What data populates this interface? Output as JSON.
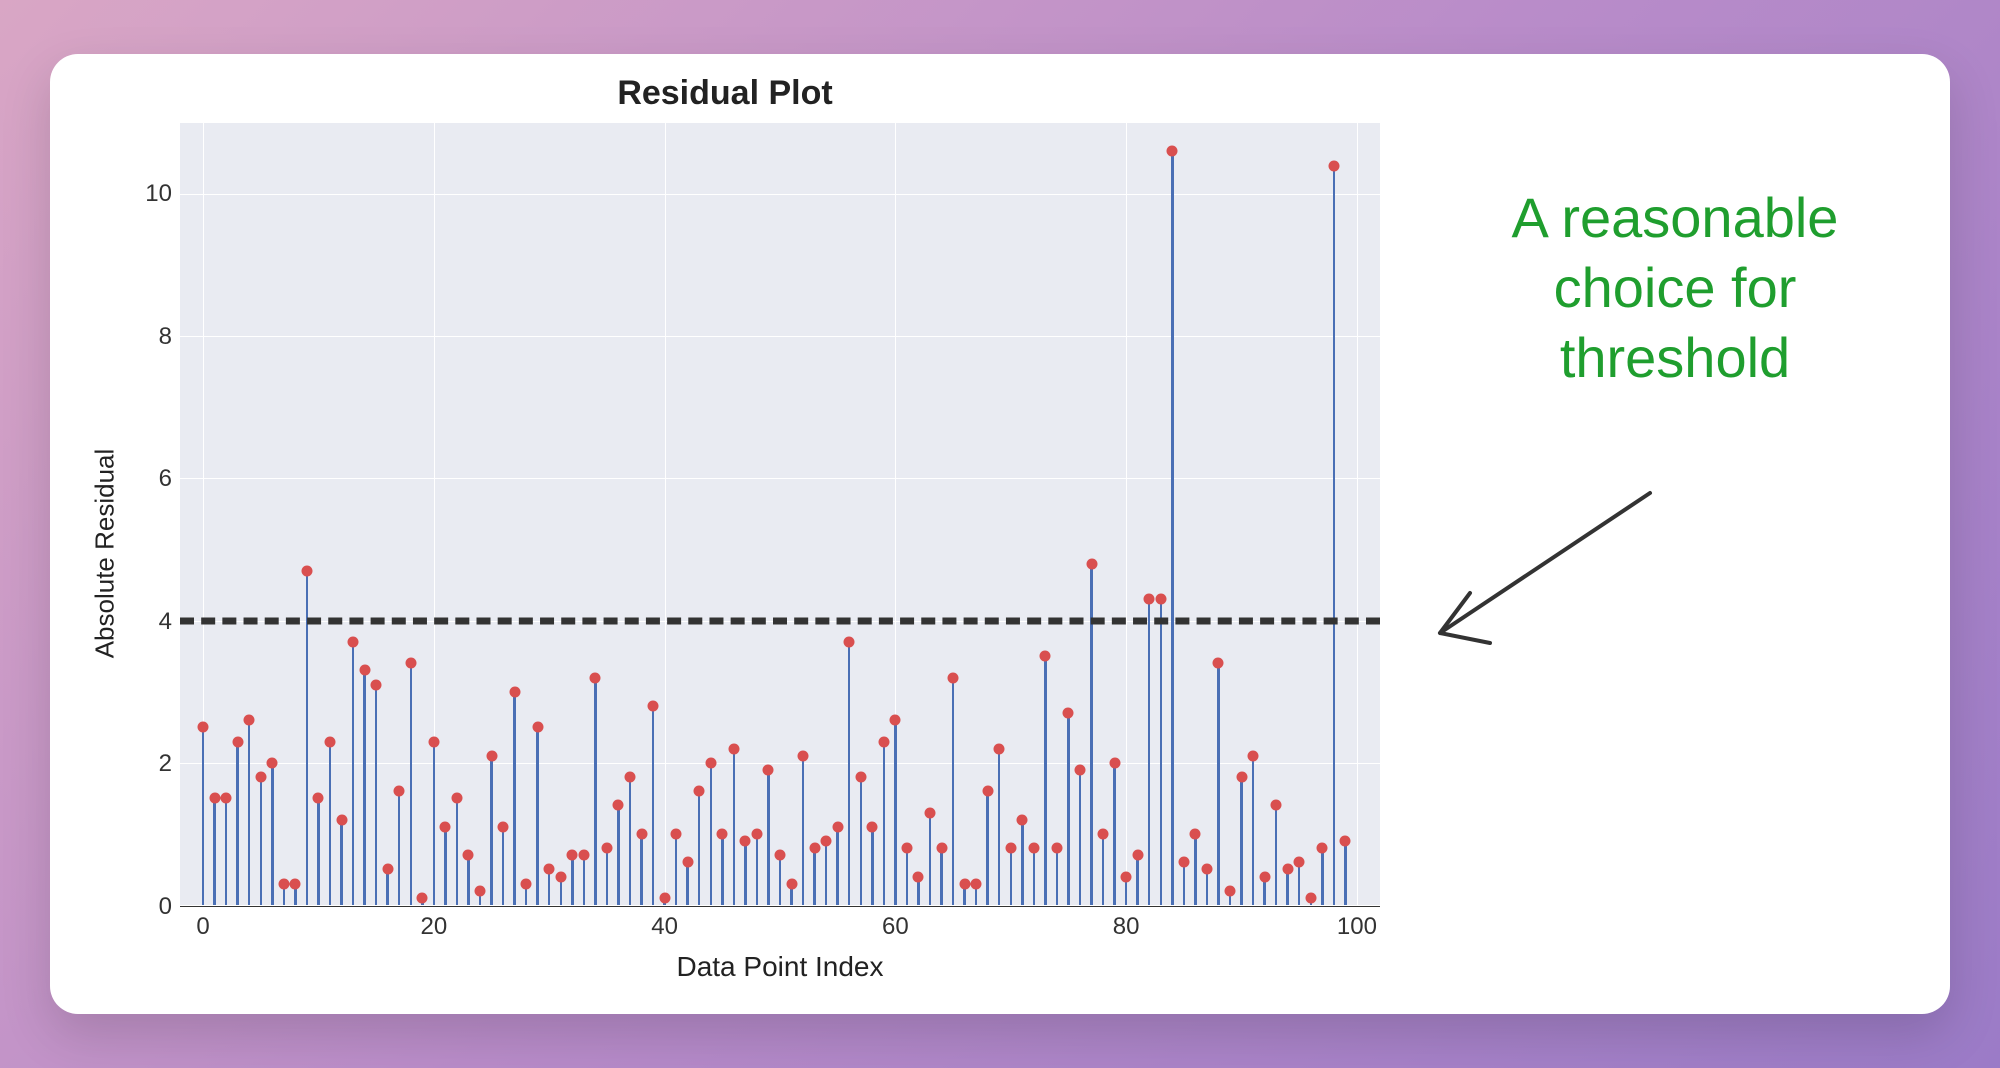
{
  "chart_data": {
    "type": "stem",
    "title": "Residual Plot",
    "xlabel": "Data Point Index",
    "ylabel": "Absolute Residual",
    "xlim": [
      -2,
      102
    ],
    "ylim": [
      0,
      11
    ],
    "xticks": [
      0,
      20,
      40,
      60,
      80,
      100
    ],
    "yticks": [
      0,
      2,
      4,
      6,
      8,
      10
    ],
    "threshold": 4,
    "x": [
      0,
      1,
      2,
      3,
      4,
      5,
      6,
      7,
      8,
      9,
      10,
      11,
      12,
      13,
      14,
      15,
      16,
      17,
      18,
      19,
      20,
      21,
      22,
      23,
      24,
      25,
      26,
      27,
      28,
      29,
      30,
      31,
      32,
      33,
      34,
      35,
      36,
      37,
      38,
      39,
      40,
      41,
      42,
      43,
      44,
      45,
      46,
      47,
      48,
      49,
      50,
      51,
      52,
      53,
      54,
      55,
      56,
      57,
      58,
      59,
      60,
      61,
      62,
      63,
      64,
      65,
      66,
      67,
      68,
      69,
      70,
      71,
      72,
      73,
      74,
      75,
      76,
      77,
      78,
      79,
      80,
      81,
      82,
      83,
      84,
      85,
      86,
      87,
      88,
      89,
      90,
      91,
      92,
      93,
      94,
      95,
      96,
      97,
      98,
      99
    ],
    "values": [
      2.5,
      1.5,
      1.5,
      2.3,
      2.6,
      1.8,
      2.0,
      0.3,
      0.3,
      4.7,
      1.5,
      2.3,
      1.2,
      3.7,
      3.3,
      3.1,
      0.5,
      1.6,
      3.4,
      0.1,
      2.3,
      1.1,
      1.5,
      0.7,
      0.2,
      2.1,
      1.1,
      3.0,
      0.3,
      2.5,
      0.5,
      0.4,
      0.7,
      0.7,
      3.2,
      0.8,
      1.4,
      1.8,
      1.0,
      2.8,
      0.1,
      1.0,
      0.6,
      1.6,
      2.0,
      1.0,
      2.2,
      0.9,
      1.0,
      1.9,
      0.7,
      0.3,
      2.1,
      0.8,
      0.9,
      1.1,
      3.7,
      1.8,
      1.1,
      2.3,
      2.6,
      0.8,
      0.4,
      1.3,
      0.8,
      3.2,
      0.3,
      0.3,
      1.6,
      2.2,
      0.8,
      1.2,
      0.8,
      3.5,
      0.8,
      2.7,
      1.9,
      4.8,
      1.0,
      2.0,
      0.4,
      0.7,
      4.3,
      4.3,
      10.6,
      0.6,
      1.0,
      0.5,
      3.4,
      0.2,
      1.8,
      2.1,
      0.4,
      1.4,
      0.5,
      0.6,
      0.1,
      0.8,
      10.4,
      0.9
    ],
    "marker_color": "#d94f4f",
    "stem_color": "#4a6fb5",
    "threshold_color": "#333333"
  },
  "annotation": {
    "line1": "A reasonable",
    "line2": "choice for",
    "line3": "threshold"
  }
}
